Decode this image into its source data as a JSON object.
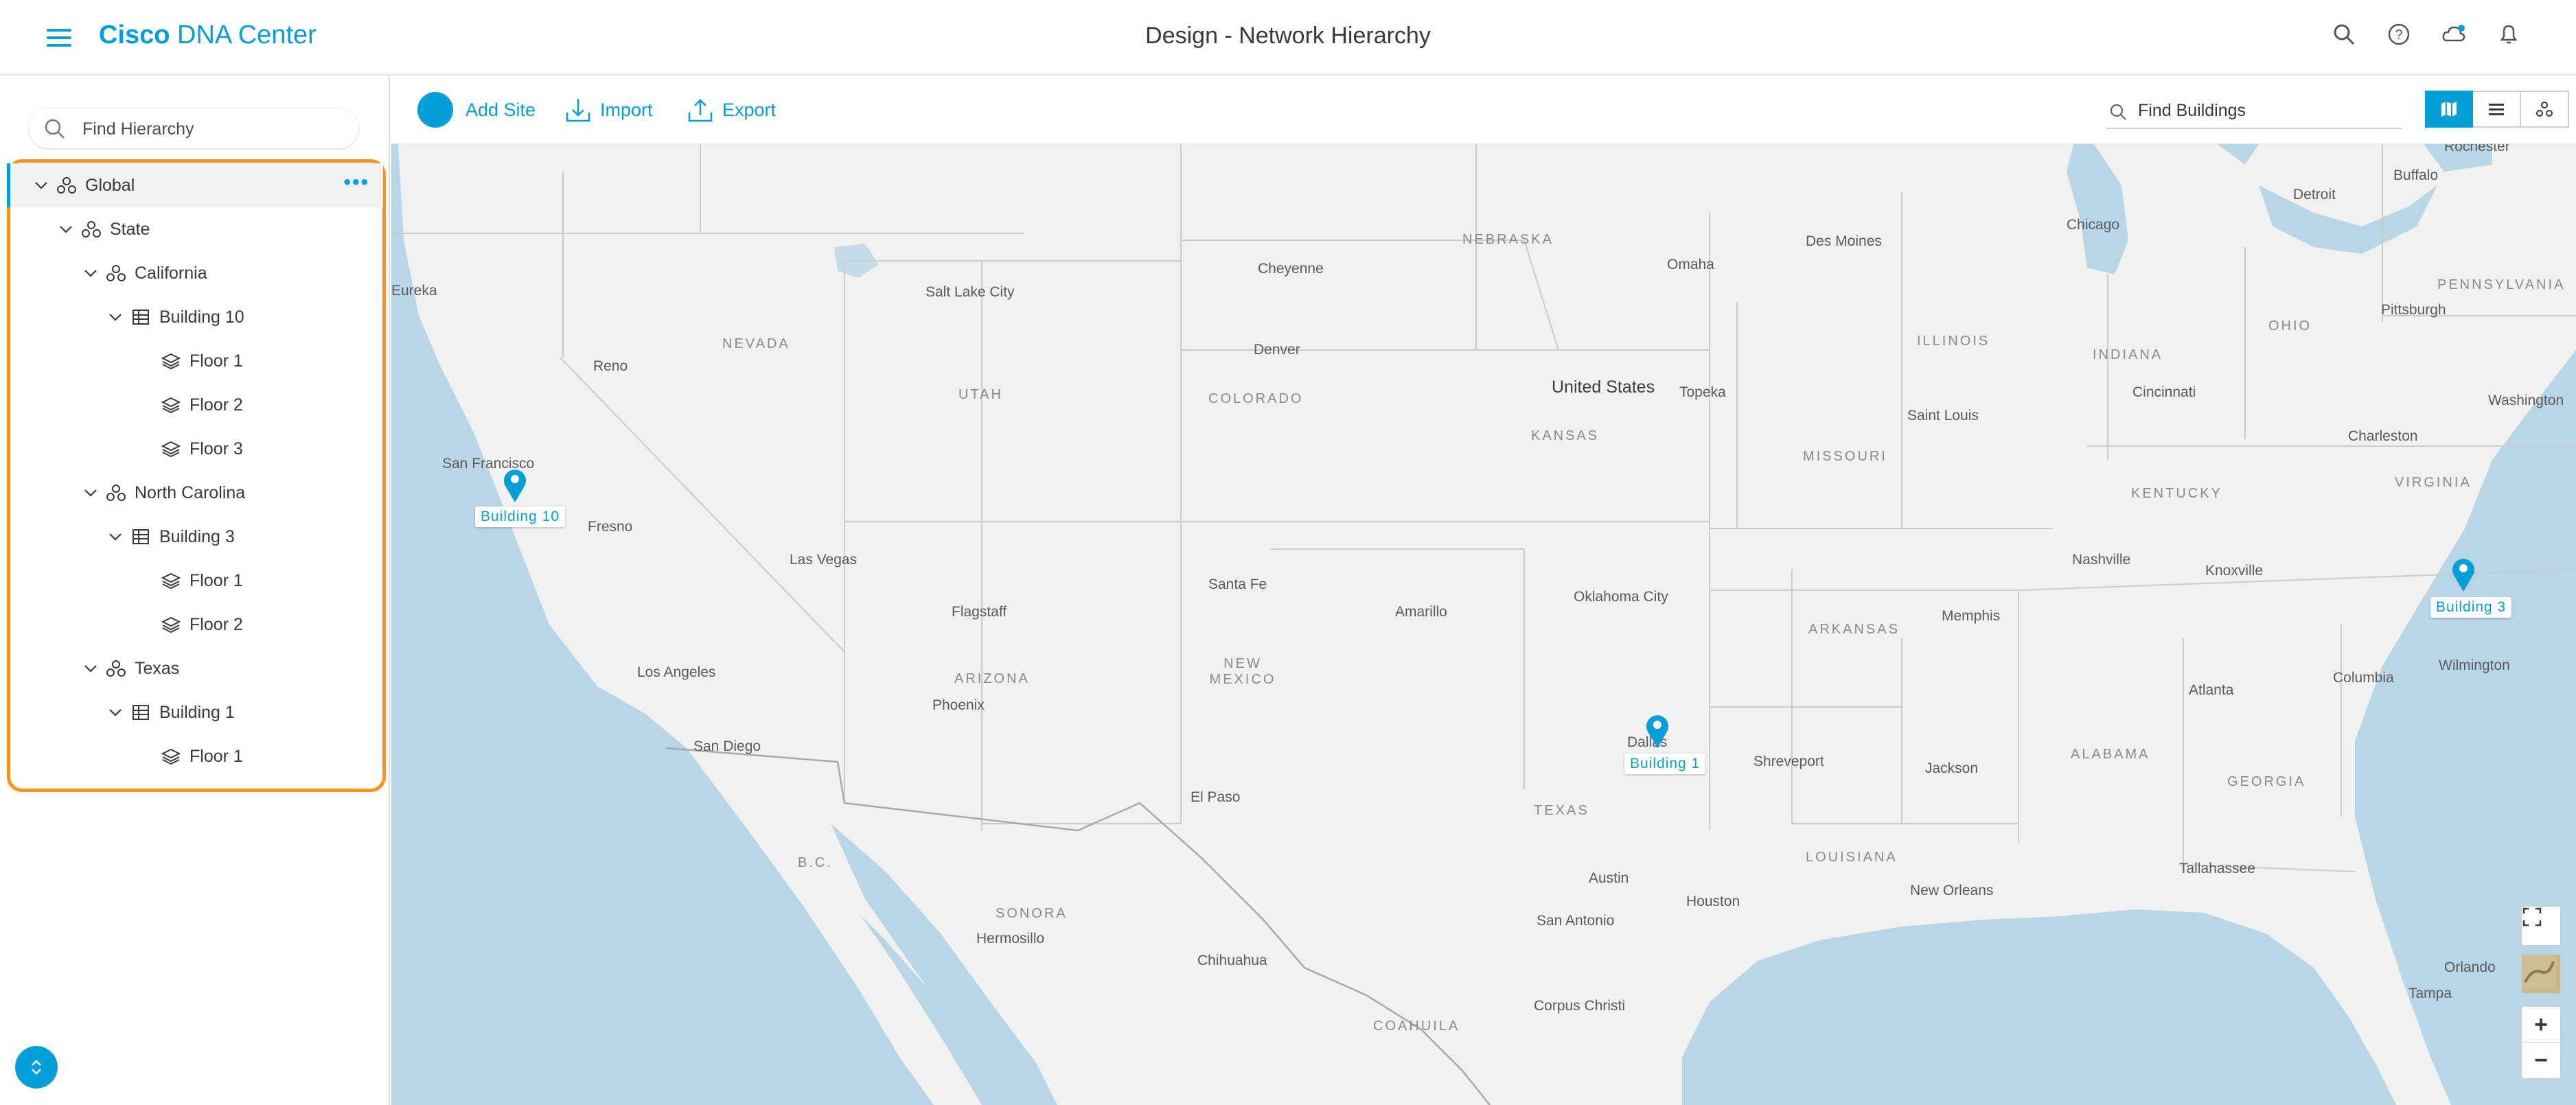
{
  "header": {
    "brand_bold": "Cisco",
    "brand_rest": "DNA Center",
    "title_section": "Design",
    "title_separator": " - ",
    "title_page": "Network Hierarchy"
  },
  "sidebar": {
    "search_placeholder": "Find Hierarchy",
    "tree": [
      {
        "label": "Global",
        "type": "area",
        "level": 0,
        "expanded": true,
        "selected": true
      },
      {
        "label": "State",
        "type": "area",
        "level": 1,
        "expanded": true
      },
      {
        "label": "California",
        "type": "area",
        "level": 2,
        "expanded": true
      },
      {
        "label": "Building 10",
        "type": "building",
        "level": 3,
        "expanded": true
      },
      {
        "label": "Floor 1",
        "type": "floor",
        "level": 4
      },
      {
        "label": "Floor 2",
        "type": "floor",
        "level": 4
      },
      {
        "label": "Floor 3",
        "type": "floor",
        "level": 4
      },
      {
        "label": "North Carolina",
        "type": "area",
        "level": 2,
        "expanded": true
      },
      {
        "label": "Building 3",
        "type": "building",
        "level": 3,
        "expanded": true
      },
      {
        "label": "Floor 1",
        "type": "floor",
        "level": 4
      },
      {
        "label": "Floor 2",
        "type": "floor",
        "level": 4
      },
      {
        "label": "Texas",
        "type": "area",
        "level": 2,
        "expanded": true
      },
      {
        "label": "Building 1",
        "type": "building",
        "level": 3,
        "expanded": true
      },
      {
        "label": "Floor 1",
        "type": "floor",
        "level": 4
      }
    ],
    "more_label": "•••"
  },
  "toolbar": {
    "add_site": "Add Site",
    "import": "Import",
    "export": "Export",
    "building_search_placeholder": "Find Buildings",
    "views": [
      "map-view-icon",
      "list-view-icon",
      "hierarchy-view-icon"
    ],
    "active_view": "map-view-icon"
  },
  "map": {
    "country_label": "United States",
    "states": [
      "NEBRASKA",
      "NEVADA",
      "UTAH",
      "COLORADO",
      "KANSAS",
      "ILLINOIS",
      "INDIANA",
      "OHIO",
      "PENNSYLVANIA",
      "MISSOURI",
      "KENTUCKY",
      "VIRGINIA",
      "ARKANSAS",
      "ARIZONA",
      "NEW MEXICO",
      "TEXAS",
      "LOUISIANA",
      "ALABAMA",
      "GEORGIA",
      "SONORA",
      "COAHUILA",
      "B.C."
    ],
    "cities": [
      "Eureka",
      "Reno",
      "Salt Lake City",
      "Cheyenne",
      "Omaha",
      "Des Moines",
      "Chicago",
      "Detroit",
      "Buffalo",
      "Rochester",
      "Pittsburgh",
      "Denver",
      "Topeka",
      "Saint Louis",
      "Cincinnati",
      "Washington",
      "Charleston",
      "San Francisco",
      "Fresno",
      "Las Vegas",
      "Santa Fe",
      "Amarillo",
      "Oklahoma City",
      "Nashville",
      "Knoxville",
      "Memphis",
      "Flagstaff",
      "Los Angeles",
      "Phoenix",
      "San Diego",
      "Atlanta",
      "Columbia",
      "Wilmington",
      "El Paso",
      "Dallas",
      "Shreveport",
      "Jackson",
      "Austin",
      "Houston",
      "New Orleans",
      "Tallahassee",
      "San Antonio",
      "Hermosillo",
      "Chihuahua",
      "Corpus Christi",
      "Orlando",
      "Tampa"
    ],
    "markers": [
      "Building 10",
      "Building 1",
      "Building 3"
    ],
    "zoom_in": "+",
    "zoom_out": "−"
  },
  "colors": {
    "accent": "#049fd9",
    "highlight": "#f7941d",
    "water": "#b8d6e6",
    "land": "#f1f1ef"
  }
}
